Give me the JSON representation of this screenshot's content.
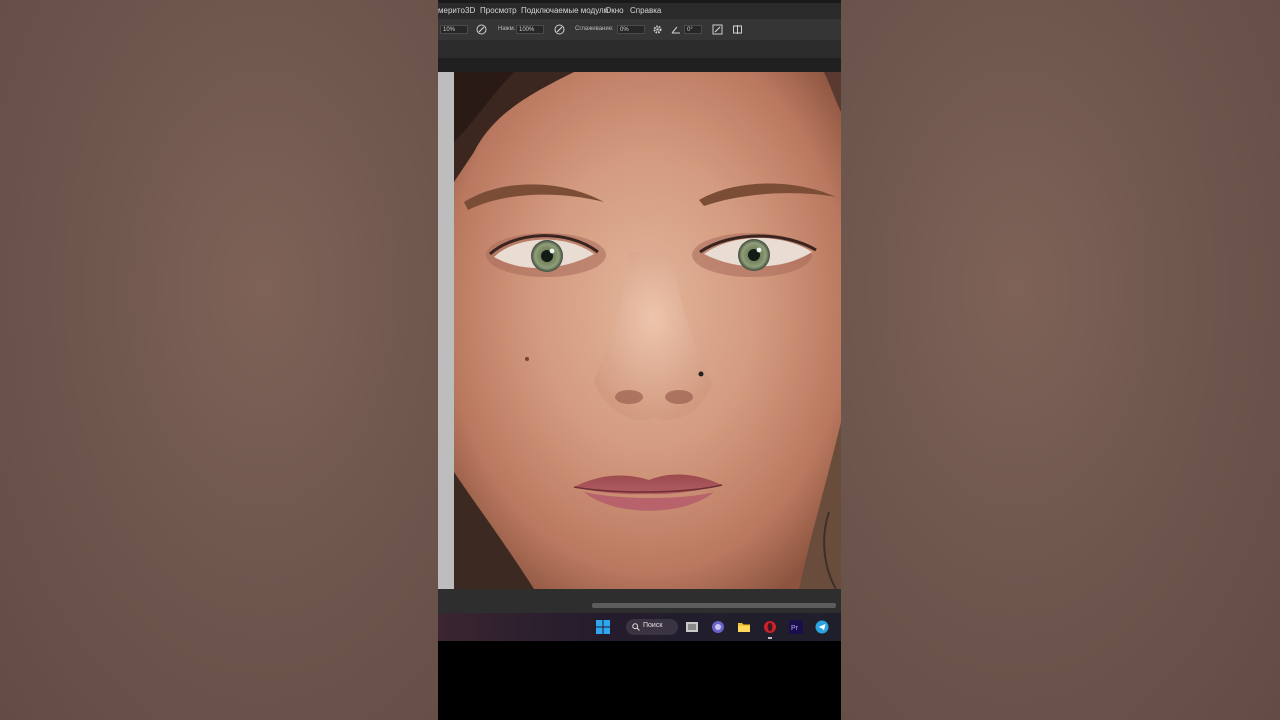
{
  "menubar": {
    "items": [
      "мерито",
      "3D",
      "Просмотр",
      "Подключаемые модули",
      "Окно",
      "Справка"
    ]
  },
  "options_bar": {
    "brush_size": "10%",
    "mode_label": "Нажм.:",
    "mode_value": "100%",
    "smoothing_label": "Сглаживание:",
    "smoothing_value": "0%",
    "angle_value": "0°"
  },
  "taskbar": {
    "search_label": "Поиск",
    "apps": [
      "windows-start",
      "search",
      "file-explorer-icon",
      "chat-icon",
      "folder-icon",
      "opera-icon",
      "premiere-icon",
      "telegram-icon"
    ]
  },
  "colors": {
    "app_bg": "#2c2c2c",
    "taskbar_bg": "#1f1f2b",
    "accent": "#0a84d6"
  }
}
